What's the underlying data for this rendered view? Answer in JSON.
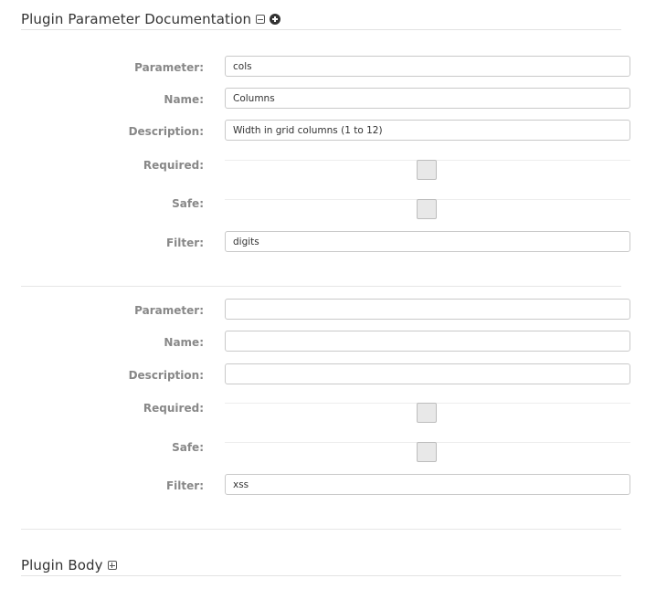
{
  "doc_section": {
    "title": "Plugin Parameter Documentation",
    "collapse_icon": "minus-box-icon",
    "add_icon": "plus-circle-icon"
  },
  "labels": {
    "parameter": "Parameter:",
    "name": "Name:",
    "description": "Description:",
    "required": "Required:",
    "safe": "Safe:",
    "filter": "Filter:"
  },
  "params": [
    {
      "parameter": "cols",
      "name": "Columns",
      "description": "Width in grid columns (1 to 12)",
      "required": false,
      "safe": false,
      "filter": "digits"
    },
    {
      "parameter": "",
      "name": "",
      "description": "",
      "required": false,
      "safe": false,
      "filter": "xss"
    }
  ],
  "body_section": {
    "title": "Plugin Body",
    "expand_icon": "plus-box-icon"
  }
}
